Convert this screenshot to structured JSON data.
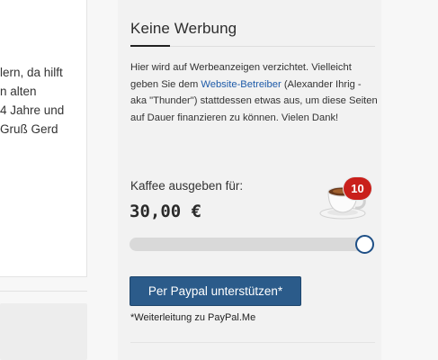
{
  "left_column": {
    "lines": [
      "lern, da hilft",
      "n alten",
      " 4 Jahre und",
      "Gruß Gerd"
    ]
  },
  "widget": {
    "heading": "Keine Werbung",
    "description_before_link": "Hier wird auf Werbeanzeigen verzichtet. Vielleicht geben Sie dem ",
    "link_text": "Website-Betreiber",
    "description_after_link": " (Alexander Ihrig - aka \"Thunder\") stattdessen etwas aus, um diese Seiten auf Dauer finanzieren zu können. Vielen Dank!",
    "coffee_label": "Kaffee ausgeben für:",
    "amount": "30,00 €",
    "cup_count": "10",
    "slider": {
      "value_fraction": 1.0
    },
    "button_label": "Per Paypal unterstützen*",
    "redirect_note": "*Weiterleitung zu PayPal.Me"
  },
  "colors": {
    "button": "#2b5b8a",
    "link": "#1d5aa8",
    "badge": "#c9201b",
    "slider_thumb_border": "#1e4f86"
  }
}
